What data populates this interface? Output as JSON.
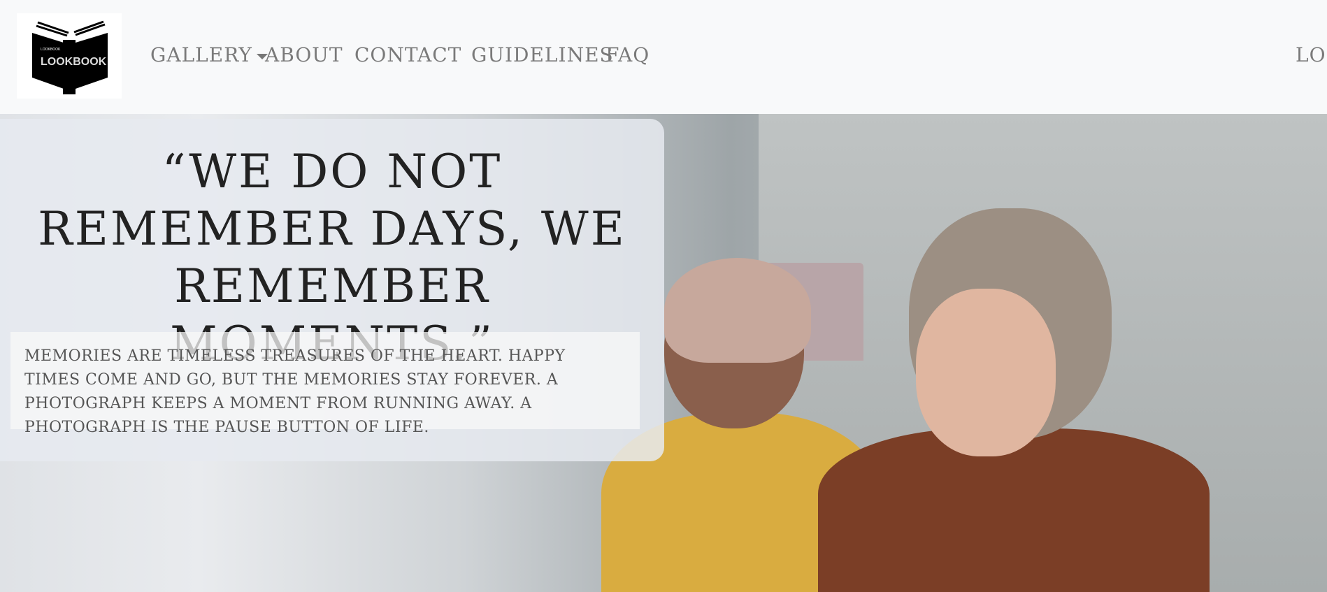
{
  "brand": {
    "logo_text": "LOOKBOOK",
    "logo_small_text": "LOOKBOOK"
  },
  "nav": {
    "items": [
      {
        "label": "GALLERY",
        "has_dropdown": true
      },
      {
        "label": "ABOUT"
      },
      {
        "label": "CONTACT"
      },
      {
        "label": "GUIDELINES"
      },
      {
        "label": "FAQ"
      }
    ],
    "right_item": "LOGIN"
  },
  "hero": {
    "quote": "“WE DO NOT REMEMBER DAYS, WE REMEMBER MOMENTS.”",
    "paragraph": "MEMORIES ARE TIMELESS TREASURES OF THE HEART. HAPPY TIMES COME AND GO, BUT THE MEMORIES STAY FOREVER. A PHOTOGRAPH KEEPS A MOMENT FROM RUNNING AWAY. A PHOTOGRAPH IS THE PAUSE BUTTON OF LIFE."
  }
}
